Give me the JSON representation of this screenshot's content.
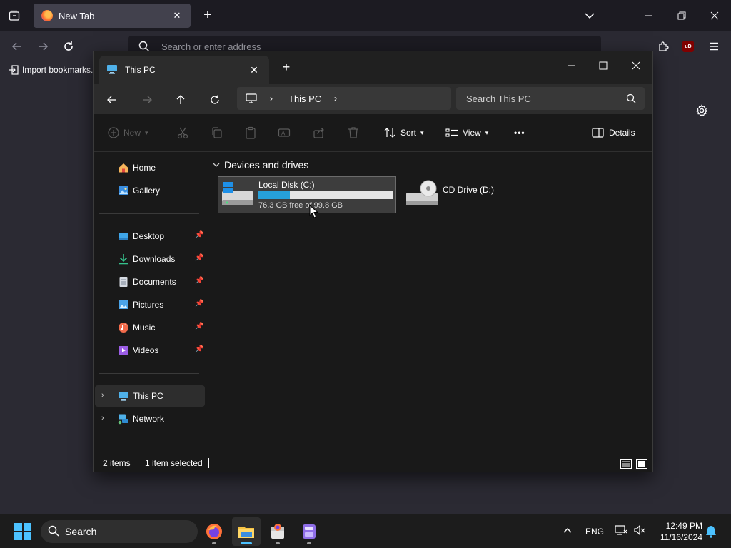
{
  "browser": {
    "tab_title": "New Tab",
    "address_placeholder": "Search or enter address",
    "bookmark_import": "Import bookmarks...",
    "extension_badge": "uD"
  },
  "explorer": {
    "tab_title": "This PC",
    "address_current": "This PC",
    "search_placeholder": "Search This PC",
    "toolbar": {
      "new": "New",
      "sort": "Sort",
      "view": "View",
      "more": "•••",
      "details": "Details"
    },
    "sidebar": {
      "home": "Home",
      "gallery": "Gallery",
      "pinned": [
        "Desktop",
        "Downloads",
        "Documents",
        "Pictures",
        "Music",
        "Videos"
      ],
      "this_pc": "This PC",
      "network": "Network"
    },
    "group_header": "Devices and drives",
    "drives": [
      {
        "name": "Local Disk (C:)",
        "free_text": "76.3 GB free of 99.8 GB",
        "used_fraction": 0.235,
        "selected": true
      },
      {
        "name": "CD Drive (D:)",
        "selected": false
      }
    ],
    "status": {
      "items": "2 items",
      "selected": "1 item selected"
    }
  },
  "taskbar": {
    "search_label": "Search",
    "apps": [
      "firefox",
      "file-explorer",
      "installer",
      "calculator"
    ],
    "active_app": "file-explorer",
    "language": "ENG",
    "time": "12:49 PM",
    "date": "11/16/2024"
  },
  "colors": {
    "accent": "#4cc2ff",
    "drive_bar_fill": "#26a0da",
    "explorer_bg": "#191919",
    "firefox_bg": "#2b2a33"
  }
}
